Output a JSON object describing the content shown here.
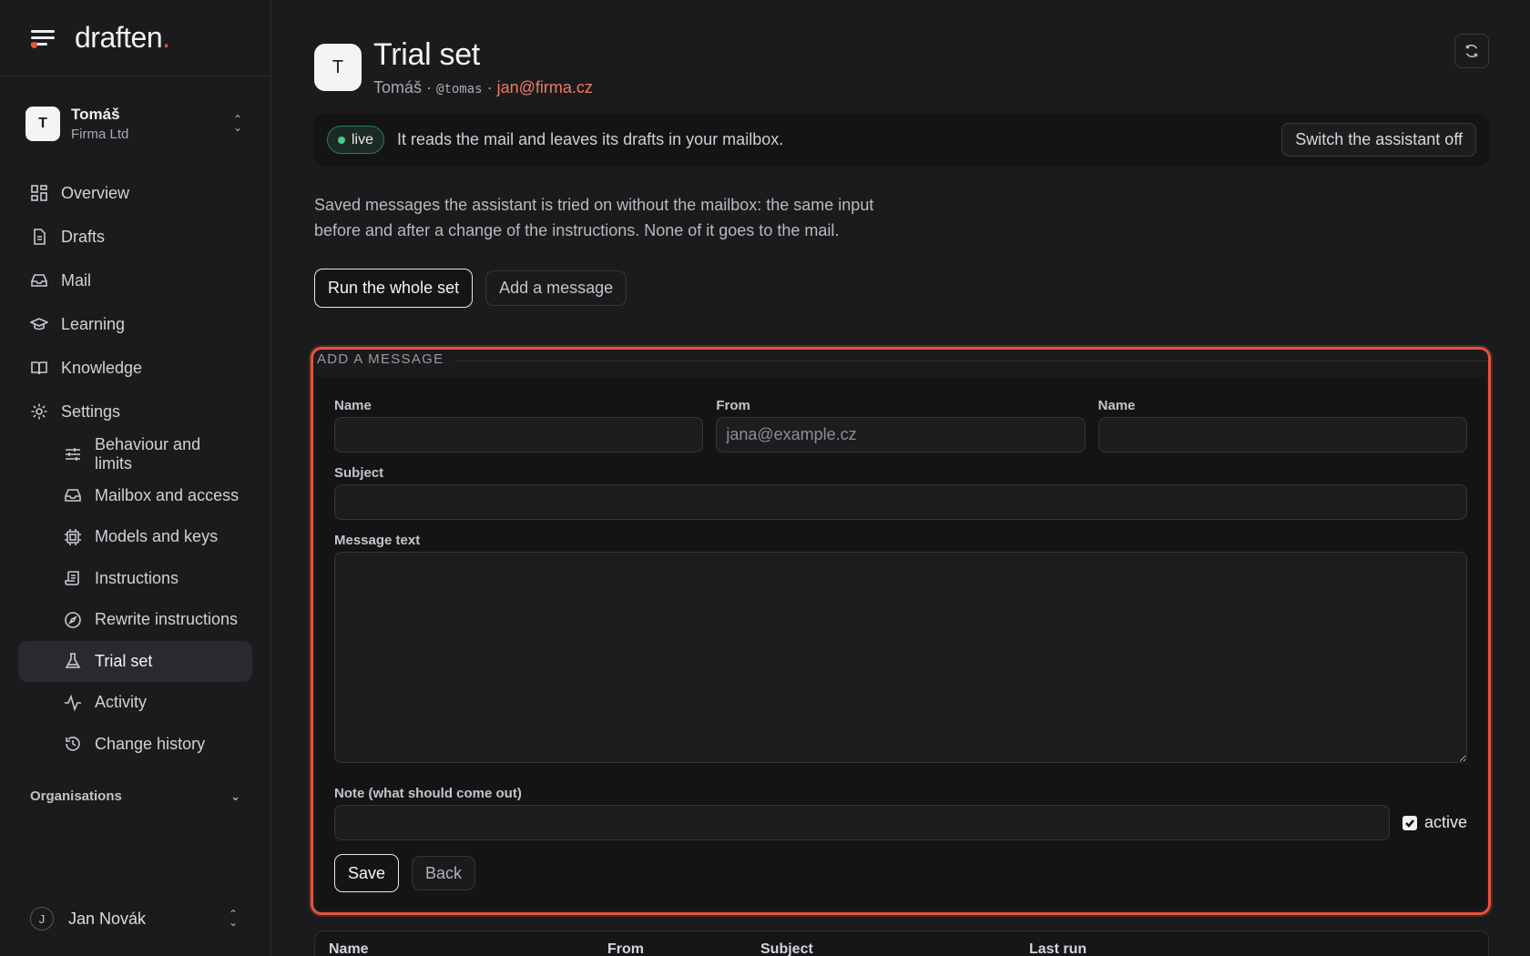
{
  "brand": {
    "logo_text": "draften",
    "logo_dot": "."
  },
  "account": {
    "initial": "T",
    "name": "Tomáš",
    "org": "Firma Ltd"
  },
  "nav": {
    "overview": "Overview",
    "drafts": "Drafts",
    "mail": "Mail",
    "learning": "Learning",
    "knowledge": "Knowledge",
    "settings": "Settings",
    "behaviour": "Behaviour and limits",
    "mailbox": "Mailbox and access",
    "models": "Models and keys",
    "instructions": "Instructions",
    "rewrite": "Rewrite instructions",
    "trial_set": "Trial set",
    "activity": "Activity",
    "history": "Change history"
  },
  "organisations_label": "Organisations",
  "user": {
    "initial": "J",
    "name": "Jan Novák"
  },
  "page": {
    "avatar": "T",
    "title": "Trial set",
    "owner": "Tomáš",
    "sep1": " · ",
    "handle": "@tomas",
    "sep2": " · ",
    "email": "jan@firma.cz"
  },
  "status": {
    "badge": "live",
    "message": "It reads the mail and leaves its drafts in your mailbox.",
    "switch_off": "Switch the assistant off"
  },
  "description": "Saved messages the assistant is tried on without the mailbox: the same input before and after a change of the instructions. None of it goes to the mail.",
  "actions": {
    "run_all": "Run the whole set",
    "add_message": "Add a message"
  },
  "form": {
    "legend": "Add a message",
    "name_label": "Name",
    "from_label": "From",
    "from_placeholder": "jana@example.cz",
    "name2_label": "Name",
    "subject_label": "Subject",
    "body_label": "Message text",
    "note_label": "Note (what should come out)",
    "active_label": "active",
    "active_checked": true,
    "save": "Save",
    "back": "Back"
  },
  "table": {
    "columns": [
      "Name",
      "From",
      "Subject",
      "Last run"
    ]
  },
  "colors": {
    "accent": "#e5533e",
    "email": "#f07a62",
    "live": "#4ccb8b"
  }
}
